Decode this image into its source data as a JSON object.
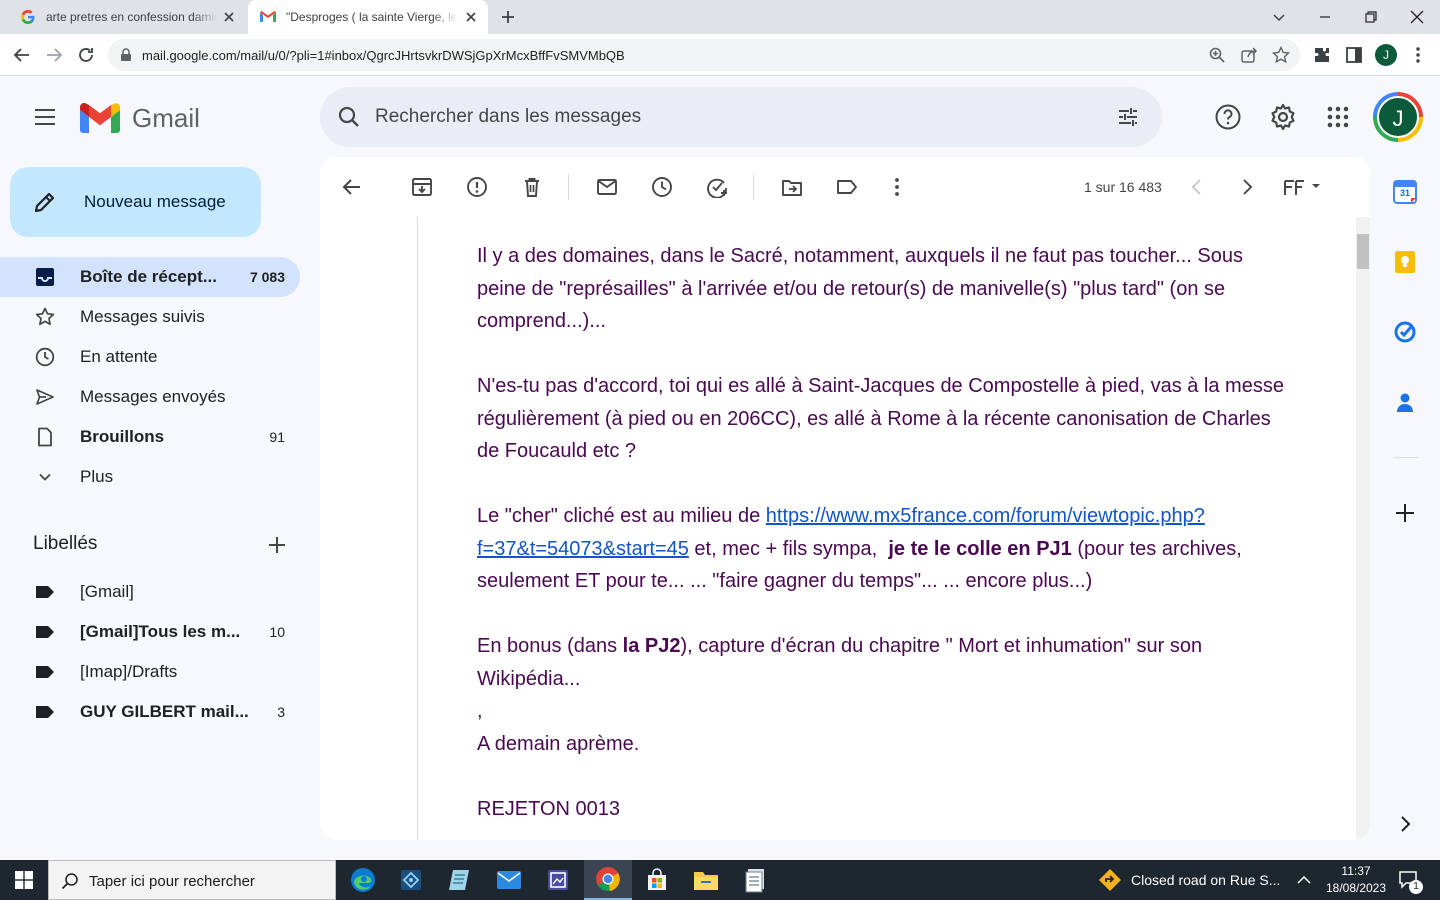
{
  "browser": {
    "tabs": [
      {
        "title": "arte pretres en confession damien"
      },
      {
        "title": "\"Desproges ( la sainte Vierge, le r"
      }
    ],
    "url": "mail.google.com/mail/u/0/?pli=1#inbox/QgrcJHrtsvkrDWSjGpXrMcxBffFvSMVMbQB",
    "profile_initial": "J"
  },
  "gmail": {
    "logo_text": "Gmail",
    "search_placeholder": "Rechercher dans les messages",
    "account_initial": "J",
    "compose_label": "Nouveau message",
    "nav": [
      {
        "label": "Boîte de récept...",
        "count": "7 083"
      },
      {
        "label": "Messages suivis",
        "count": ""
      },
      {
        "label": "En attente",
        "count": ""
      },
      {
        "label": "Messages envoyés",
        "count": ""
      },
      {
        "label": "Brouillons",
        "count": "91"
      },
      {
        "label": "Plus",
        "count": ""
      }
    ],
    "labels_heading": "Libellés",
    "labels": [
      {
        "label": "[Gmail]",
        "count": ""
      },
      {
        "label": "[Gmail]Tous les m...",
        "count": "10"
      },
      {
        "label": "[Imap]/Drafts",
        "count": ""
      },
      {
        "label": "GUY GILBERT mail...",
        "count": "3"
      }
    ],
    "pagination": "1 sur 16 483",
    "calendar_day": "31",
    "message": {
      "p1": "Il y a des domaines, dans le Sacré, notamment, auxquels il ne faut pas toucher... Sous peine de \"représailles\" à l'arrivée et/ou de retour(s) de manivelle(s) \"plus tard\" (on se comprend...)...",
      "p2": "N'es-tu pas d'accord, toi qui es allé à Saint-Jacques de Compostelle à pied, vas à la messe régulièrement (à pied ou en 206CC), es allé à Rome à la récente canonisation de Charles de Foucauld etc ?",
      "p3_a": "Le \"cher\" cliché est au milieu de ",
      "p3_link": "https://www.mx5france.com/forum/viewtopic.php?f=37&t=54073&start=45",
      "p3_b": " et, mec + fils sympa,  ",
      "p3_bold": "je te le colle en PJ1",
      "p3_c": " (pour tes archives, seulement ET pour te... ... \"faire gagner du temps\"... ... encore plus...)",
      "p4_a": "En bonus (dans ",
      "p4_bold": "la PJ2",
      "p4_b": "), capture d'écran du chapitre \" Mort et inhumation\" sur son Wikipédia...",
      "p5": ",",
      "p6": "A demain aprème.",
      "p7": "REJETON 0013"
    }
  },
  "taskbar": {
    "search_placeholder": "Taper ici pour rechercher",
    "notification": "Closed road on Rue S...",
    "time": "11:37",
    "date": "18/08/2023",
    "notif_count": "1"
  },
  "colors": {
    "message_text": "#4a0852",
    "link": "#1155cc",
    "nav_active": "#d3e3fd",
    "compose_bg": "#c2e7ff"
  }
}
